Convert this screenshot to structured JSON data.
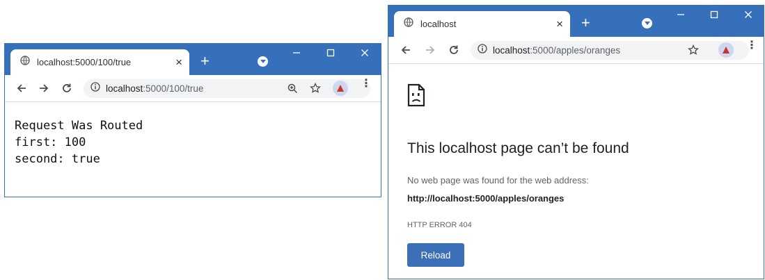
{
  "colors": {
    "frame": "#3670bb",
    "button": "#3b6fb8"
  },
  "window1": {
    "tab_title": "localhost:5000/100/true",
    "tab_close": "×",
    "new_tab": "+",
    "url_host": "localhost",
    "url_rest": ":5000/100/true",
    "content_lines": [
      "Request Was Routed",
      "first: 100",
      "second: true"
    ]
  },
  "window2": {
    "tab_title": "localhost",
    "tab_close": "×",
    "new_tab": "+",
    "url_host": "localhost",
    "url_rest": ":5000/apples/oranges",
    "error": {
      "title": "This localhost page can’t be found",
      "description": "No web page was found for the web address:",
      "url": "http://localhost:5000/apples/oranges",
      "code": "HTTP ERROR 404",
      "reload_label": "Reload"
    }
  }
}
